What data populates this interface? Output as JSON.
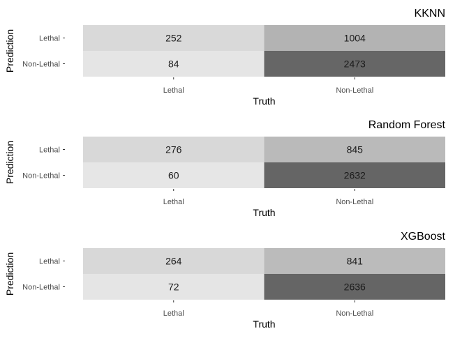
{
  "chart_data": [
    {
      "type": "heatmap",
      "title": "KKNN",
      "xlabel": "Truth",
      "ylabel": "Prediction",
      "x_categories": [
        "Lethal",
        "Non-Lethal"
      ],
      "y_categories": [
        "Lethal",
        "Non-Lethal"
      ],
      "values": [
        [
          252,
          1004
        ],
        [
          84,
          2473
        ]
      ],
      "colors": [
        [
          "#d9d9d9",
          "#b3b3b3"
        ],
        [
          "#e5e5e5",
          "#666666"
        ]
      ]
    },
    {
      "type": "heatmap",
      "title": "Random Forest",
      "xlabel": "Truth",
      "ylabel": "Prediction",
      "x_categories": [
        "Lethal",
        "Non-Lethal"
      ],
      "y_categories": [
        "Lethal",
        "Non-Lethal"
      ],
      "values": [
        [
          276,
          845
        ],
        [
          60,
          2632
        ]
      ],
      "colors": [
        [
          "#d8d8d8",
          "#bababa"
        ],
        [
          "#e6e6e6",
          "#656565"
        ]
      ]
    },
    {
      "type": "heatmap",
      "title": "XGBoost",
      "xlabel": "Truth",
      "ylabel": "Prediction",
      "x_categories": [
        "Lethal",
        "Non-Lethal"
      ],
      "y_categories": [
        "Lethal",
        "Non-Lethal"
      ],
      "values": [
        [
          264,
          841
        ],
        [
          72,
          2636
        ]
      ],
      "colors": [
        [
          "#d8d8d8",
          "#bbbbbb"
        ],
        [
          "#e5e5e5",
          "#656565"
        ]
      ]
    }
  ]
}
